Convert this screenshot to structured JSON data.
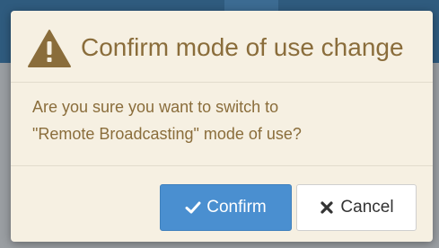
{
  "dialog": {
    "title": "Confirm mode of use change",
    "icon": "warning-triangle-icon",
    "message_line1": "Are you sure you want to switch to",
    "message_line2": "\"Remote Broadcasting\" mode of use?",
    "confirm_label": "Confirm",
    "cancel_label": "Cancel",
    "confirm_icon": "check-icon",
    "cancel_icon": "close-icon"
  },
  "colors": {
    "dialog_bg": "#f6f0e2",
    "title_text": "#8a6d3b",
    "confirm_bg": "#4a8fd0",
    "cancel_bg": "#ffffff",
    "backdrop_header": "#2f5b7e"
  }
}
